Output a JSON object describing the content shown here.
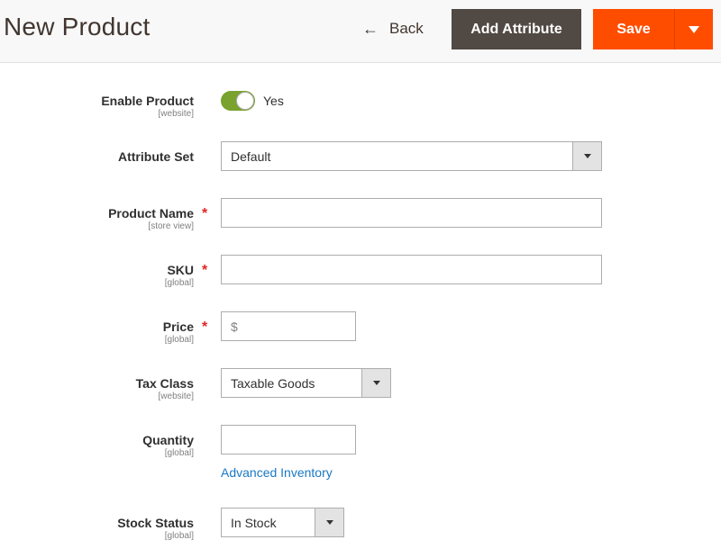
{
  "header": {
    "title": "New Product",
    "back_label": "Back",
    "add_attribute_label": "Add Attribute",
    "save_label": "Save"
  },
  "colors": {
    "save": "#ff4d00",
    "add_attribute": "#514943",
    "toggle_on": "#79a22e",
    "link": "#1979c3",
    "required": "#e22626"
  },
  "form": {
    "enable_product": {
      "label": "Enable Product",
      "scope": "[website]",
      "value": "Yes",
      "checked": true
    },
    "attribute_set": {
      "label": "Attribute Set",
      "value": "Default"
    },
    "product_name": {
      "label": "Product Name",
      "scope": "[store view]",
      "value": "",
      "required": "*"
    },
    "sku": {
      "label": "SKU",
      "scope": "[global]",
      "value": "",
      "required": "*"
    },
    "price": {
      "label": "Price",
      "scope": "[global]",
      "prefix": "$",
      "value": "",
      "required": "*"
    },
    "tax_class": {
      "label": "Tax Class",
      "scope": "[website]",
      "value": "Taxable Goods"
    },
    "quantity": {
      "label": "Quantity",
      "scope": "[global]",
      "value": ""
    },
    "advanced_inventory_label": "Advanced Inventory",
    "stock_status": {
      "label": "Stock Status",
      "scope": "[global]",
      "value": "In Stock"
    }
  }
}
